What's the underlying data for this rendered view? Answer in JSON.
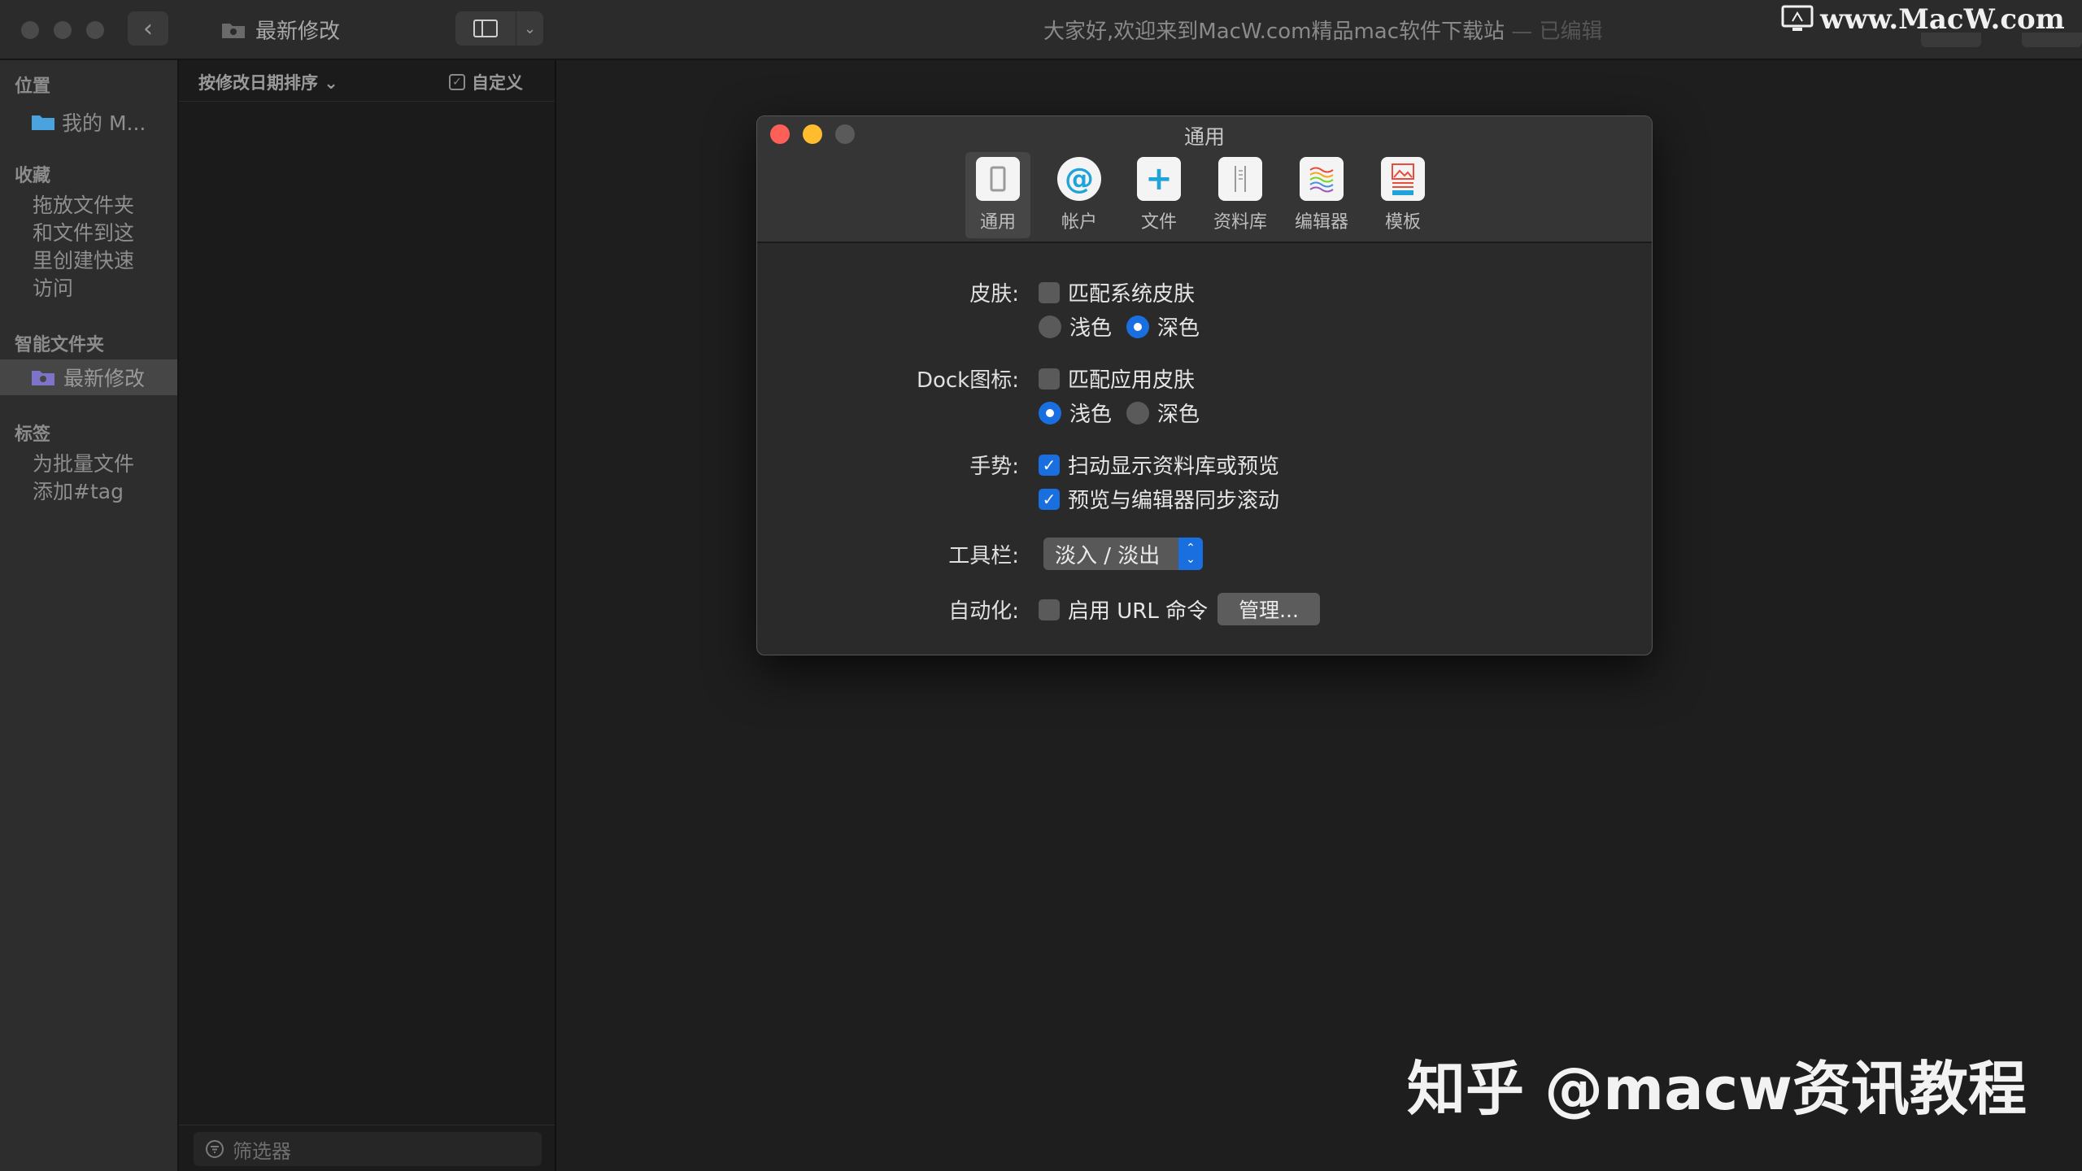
{
  "window": {
    "folder_title": "最新修改",
    "doc_title": "大家好,欢迎来到MacW.com精品mac软件下载站",
    "doc_status": "— 已编辑"
  },
  "watermarks": {
    "top": "www.MacW.com",
    "bottom": "知乎 @macw资讯教程"
  },
  "sidebar": {
    "location_header": "位置",
    "location_item": "我的 M...",
    "favorites_header": "收藏",
    "favorites_hint": [
      "拖放文件夹",
      "和文件到这",
      "里创建快速",
      "访问"
    ],
    "smart_header": "智能文件夹",
    "smart_item": "最新修改",
    "tags_header": "标签",
    "tags_hint": [
      "为批量文件",
      "添加#tag"
    ]
  },
  "notelist": {
    "sort_label": "按修改日期排序 ⌄",
    "custom_label": "自定义",
    "filter_placeholder": "筛选器"
  },
  "prefs": {
    "title": "通用",
    "tabs": [
      {
        "label": "通用",
        "icon": "general-icon"
      },
      {
        "label": "帐户",
        "icon": "account-at-icon"
      },
      {
        "label": "文件",
        "icon": "add-file-icon"
      },
      {
        "label": "资料库",
        "icon": "library-icon"
      },
      {
        "label": "编辑器",
        "icon": "editor-icon"
      },
      {
        "label": "模板",
        "icon": "template-icon"
      }
    ],
    "skin_label": "皮肤:",
    "skin_match_system": "匹配系统皮肤",
    "skin_light": "浅色",
    "skin_dark": "深色",
    "dock_label": "Dock图标:",
    "dock_match_app": "匹配应用皮肤",
    "dock_light": "浅色",
    "dock_dark": "深色",
    "gesture_label": "手势:",
    "gesture_swipe": "扫动显示资料库或预览",
    "gesture_sync": "预览与编辑器同步滚动",
    "toolbar_label": "工具栏:",
    "toolbar_value": "淡入 / 淡出",
    "automation_label": "自动化:",
    "automation_url": "启用 URL 命令",
    "manage_button": "管理..."
  },
  "colors": {
    "accent": "#1a6fe0",
    "close": "#fe5f57",
    "minimize": "#febc2e",
    "background": "#1e1e1e"
  }
}
